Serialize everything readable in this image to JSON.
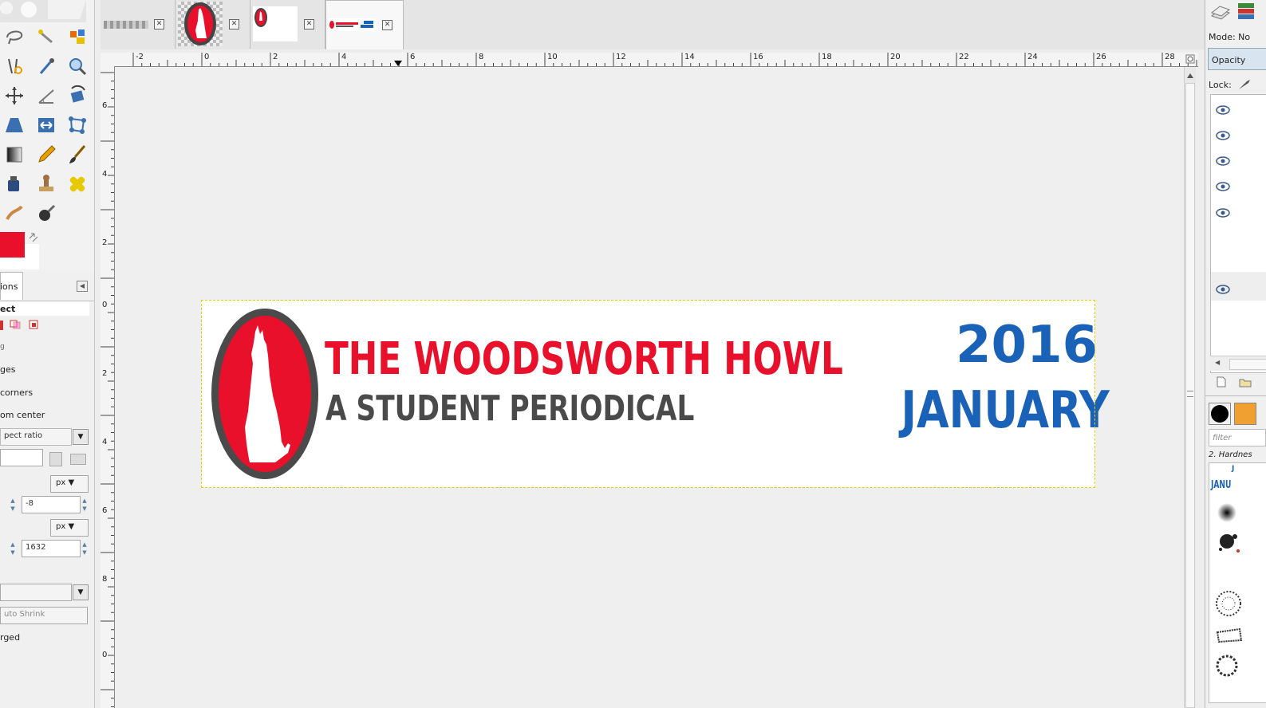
{
  "tool_options": {
    "tab_label": "ions",
    "title": "ect",
    "opt1": "g",
    "expand_from_center_partial": "om center",
    "rounded_corners_partial": "corners",
    "edges_partial": "ges",
    "fixed_select": "pect ratio",
    "unit1": "px",
    "field_value_1": "-8",
    "unit2": "px",
    "field_value_2": "1632",
    "auto_shrink": "uto Shrink",
    "merged_partial": "rged"
  },
  "image_tabs": [
    {
      "name": "checker-image"
    },
    {
      "name": "wolf-logo-image"
    },
    {
      "name": "wolf-small-image"
    },
    {
      "name": "banner-image"
    }
  ],
  "ruler": {
    "h_labels": [
      "-2",
      "0",
      "2",
      "4",
      "6",
      "8",
      "10",
      "12",
      "14",
      "16",
      "18",
      "20",
      "22",
      "24",
      "26",
      "28"
    ],
    "v_labels": [
      "6",
      "4",
      "2",
      "0",
      "2",
      "4",
      "6",
      "8",
      "0"
    ]
  },
  "banner": {
    "title": "THE WOODSWORTH HOWL",
    "subtitle": "A STUDENT PERIODICAL",
    "year": "2016",
    "month": "JANUARY"
  },
  "right_dock": {
    "mode_label": "Mode: No",
    "opacity_label": "Opacity",
    "lock_label": "Lock:",
    "filter_placeholder": "filter",
    "brush_name": "2. Hardnes",
    "brush_thumb_text_top": "J",
    "brush_thumb_text": "JANU"
  },
  "colors": {
    "accent_red": "#e8102a",
    "dark_gray": "#404040",
    "blue": "#1a62b8"
  }
}
